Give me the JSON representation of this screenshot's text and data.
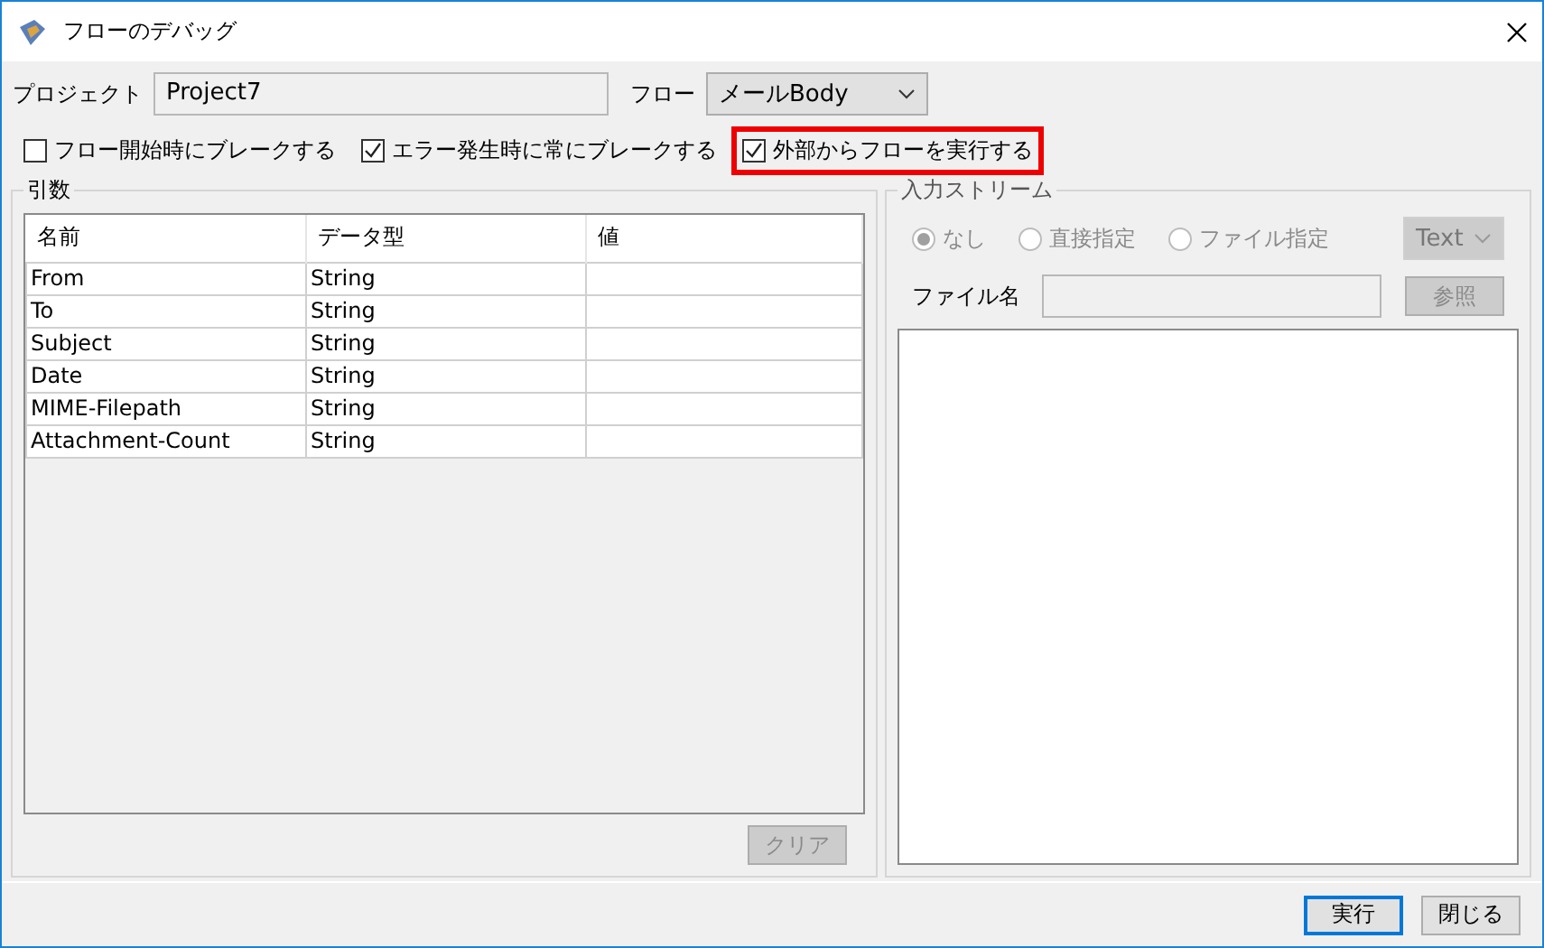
{
  "window": {
    "title": "フローのデバッグ"
  },
  "project": {
    "label": "プロジェクト",
    "value": "Project7"
  },
  "flow": {
    "label": "フロー",
    "value": "メールBody"
  },
  "options": [
    {
      "label": "フロー開始時にブレークする",
      "checked": false,
      "highlighted": false
    },
    {
      "label": "エラー発生時に常にブレークする",
      "checked": true,
      "highlighted": false
    },
    {
      "label": "外部からフローを実行する",
      "checked": true,
      "highlighted": true
    }
  ],
  "arguments": {
    "title": "引数",
    "columns": [
      "名前",
      "データ型",
      "値"
    ],
    "rows": [
      [
        "From",
        "String",
        ""
      ],
      [
        "To",
        "String",
        ""
      ],
      [
        "Subject",
        "String",
        ""
      ],
      [
        "Date",
        "String",
        ""
      ],
      [
        "MIME-Filepath",
        "String",
        ""
      ],
      [
        "Attachment-Count",
        "String",
        ""
      ]
    ],
    "clear_button": {
      "label": "クリア",
      "disabled": true
    }
  },
  "input_stream": {
    "title": "入力ストリーム",
    "radios": [
      {
        "label": "なし",
        "selected": true,
        "disabled": true
      },
      {
        "label": "直接指定",
        "selected": false,
        "disabled": true
      },
      {
        "label": "ファイル指定",
        "selected": false,
        "disabled": true
      }
    ],
    "format": {
      "value": "Text",
      "disabled": true
    },
    "file_name": {
      "label": "ファイル名",
      "disabled": true
    },
    "browse_button": {
      "label": "参照",
      "disabled": true
    }
  },
  "buttons": [
    {
      "label": "実行",
      "default": true
    },
    {
      "label": "閉じる",
      "default": false
    }
  ]
}
